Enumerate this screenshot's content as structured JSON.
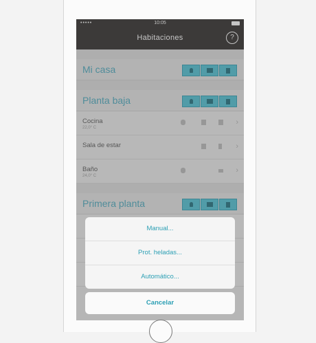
{
  "status_bar": {
    "signal": "•••••",
    "time": "10:05"
  },
  "nav": {
    "title": "Habitaciones",
    "help": "?"
  },
  "sections": [
    {
      "name": "Mi casa"
    },
    {
      "name": "Planta baja"
    },
    {
      "name": "Primera planta"
    }
  ],
  "rooms_planta_baja": [
    {
      "label": "Cocina",
      "temp": "22,0° C"
    },
    {
      "label": "Sala de estar",
      "temp": ""
    },
    {
      "label": "Baño",
      "temp": "24,0° C"
    }
  ],
  "action_sheet": {
    "options": [
      "Manual...",
      "Prot. heladas...",
      "Automático..."
    ],
    "cancel": "Cancelar"
  },
  "icons": {
    "accent": "#4ec0d3",
    "text_accent": "#2b9fb4"
  }
}
